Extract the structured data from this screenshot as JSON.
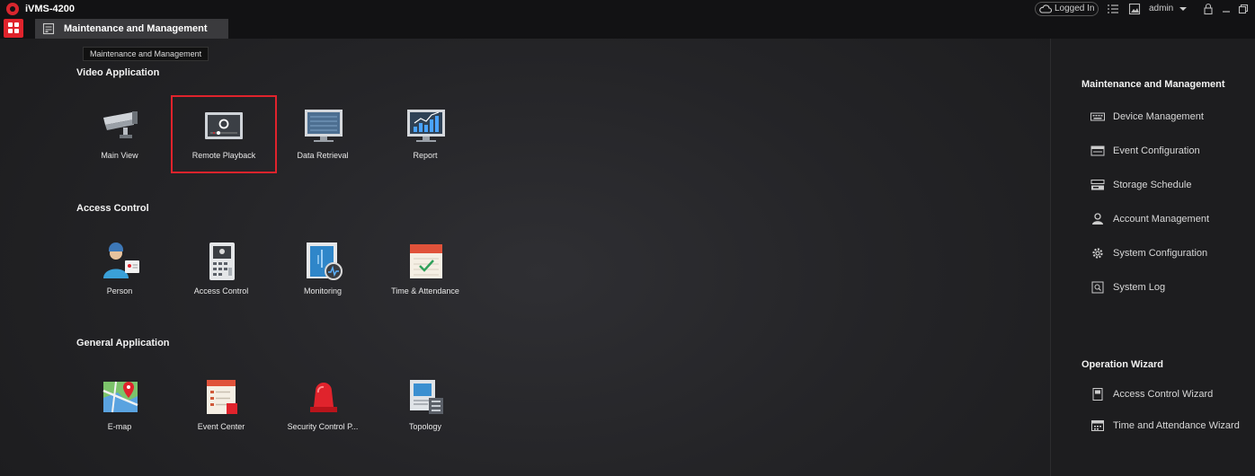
{
  "app": {
    "title": "iVMS-4200"
  },
  "topbar": {
    "login_status": "Logged In",
    "user": "admin"
  },
  "tab": {
    "label": "Maintenance and Management",
    "tooltip": "Maintenance and Management"
  },
  "sections": [
    {
      "title": "Video Application",
      "tiles": [
        {
          "label": "Main View",
          "icon": "camera-icon"
        },
        {
          "label": "Remote Playback",
          "icon": "playback-icon",
          "selected": true
        },
        {
          "label": "Data Retrieval",
          "icon": "monitor-icon"
        },
        {
          "label": "Report",
          "icon": "bar-chart-icon"
        }
      ]
    },
    {
      "title": "Access Control",
      "tiles": [
        {
          "label": "Person",
          "icon": "person-card-icon"
        },
        {
          "label": "Access Control",
          "icon": "keypad-icon"
        },
        {
          "label": "Monitoring",
          "icon": "door-monitor-icon"
        },
        {
          "label": "Time & Attendance",
          "icon": "calendar-icon"
        }
      ]
    },
    {
      "title": "General Application",
      "tiles": [
        {
          "label": "E-map",
          "icon": "map-icon"
        },
        {
          "label": "Event Center",
          "icon": "event-list-icon"
        },
        {
          "label": "Security Control P...",
          "icon": "alarm-light-icon"
        },
        {
          "label": "Topology",
          "icon": "topology-icon"
        }
      ]
    }
  ],
  "sidebar": {
    "maintenance_title": "Maintenance and Management",
    "maintenance_items": [
      {
        "label": "Device Management",
        "icon": "keyboard-icon"
      },
      {
        "label": "Event Configuration",
        "icon": "event-config-icon"
      },
      {
        "label": "Storage Schedule",
        "icon": "storage-icon"
      },
      {
        "label": "Account Management",
        "icon": "user-icon"
      },
      {
        "label": "System Configuration",
        "icon": "gear-icon"
      },
      {
        "label": "System Log",
        "icon": "log-icon"
      }
    ],
    "wizard_title": "Operation Wizard",
    "wizard_items": [
      {
        "label": "Access Control Wizard",
        "icon": "wizard-doc-icon"
      },
      {
        "label": "Time and Attendance Wizard",
        "icon": "wizard-calendar-icon"
      }
    ]
  },
  "colors": {
    "accent": "#e0232c",
    "background": "#1e1e20"
  }
}
